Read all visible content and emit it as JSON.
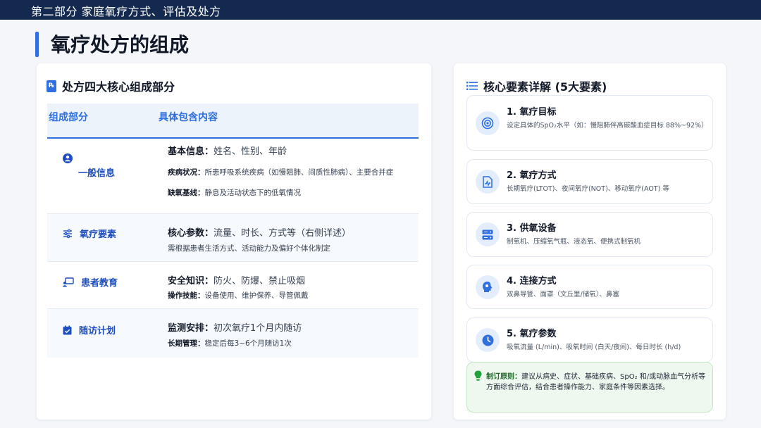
{
  "header": {
    "section_title": "第二部分 家庭氧疗方式、评估及处方"
  },
  "page": {
    "title": "氧疗处方的组成"
  },
  "left_card": {
    "title": "处方四大核心组成部分",
    "columns": [
      "组成部分",
      "具体包含内容"
    ],
    "rows": [
      {
        "component": "一般信息",
        "icon": "user-icon",
        "lines": [
          {
            "label": "基本信息：",
            "text": "姓名、性别、年龄"
          },
          {
            "label": "疾病状况：",
            "text": "所患呼吸系统疾病（如慢阻肺、间质性肺病）、主要合并症"
          },
          {
            "label": "缺氧基线：",
            "text": "静息及活动状态下的低氧情况"
          }
        ]
      },
      {
        "component": "氧疗要素",
        "icon": "sliders-icon",
        "lines": [
          {
            "label": "核心参数：",
            "text": "流量、时长、方式等（右侧详述）"
          },
          {
            "label": "",
            "text": "需根据患者生活方式、活动能力及偏好个体化制定"
          }
        ]
      },
      {
        "component": "患者教育",
        "icon": "teacher-icon",
        "lines": [
          {
            "label": "安全知识：",
            "text": "防火、防爆、禁止吸烟"
          },
          {
            "label": "操作技能：",
            "text": "设备使用、维护保养、导管佩戴"
          }
        ]
      },
      {
        "component": "随访计划",
        "icon": "calendar-check-icon",
        "lines": [
          {
            "label": "监测安排：",
            "text": "初次氧疗1个月内随访"
          },
          {
            "label": "长期管理：",
            "text": "稳定后每3~6个月随访1次"
          }
        ]
      }
    ]
  },
  "right_card": {
    "title": "核心要素详解 (5大要素)",
    "items": [
      {
        "name": "1. 氧疗目标",
        "icon": "target-icon",
        "desc": "设定具体的SpO₂水平（如：慢阻肺伴高碳酸血症目标 88%~92%）"
      },
      {
        "name": "2. 氧疗方式",
        "icon": "medical-file-icon",
        "desc": "长期氧疗(LTOT)、夜间氧疗(NOT)、移动氧疗(AOT) 等"
      },
      {
        "name": "3. 供氧设备",
        "icon": "server-icon",
        "desc": "制氧机、压缩氧气瓶、液态氧、便携式制氧机"
      },
      {
        "name": "4. 连接方式",
        "icon": "head-icon",
        "desc": "双鼻导管、面罩（文丘里/储氧）、鼻塞"
      },
      {
        "name": "5. 氧疗参数",
        "icon": "clock-icon",
        "desc": "吸氧流量 (L/min)、吸氧时间 (白天/夜间)、每日时长 (h/d)"
      }
    ],
    "principle": {
      "label": "制订原则：",
      "text": "建议从病史、症状、基础疾病、SpO₂ 和/或动脉血气分析等方面综合评估，结合患者操作能力、家庭条件等因素选择。"
    }
  },
  "colors": {
    "accent": "#2f6fe0",
    "header_bg": "#14294f",
    "success_bg": "#eef8ee"
  }
}
